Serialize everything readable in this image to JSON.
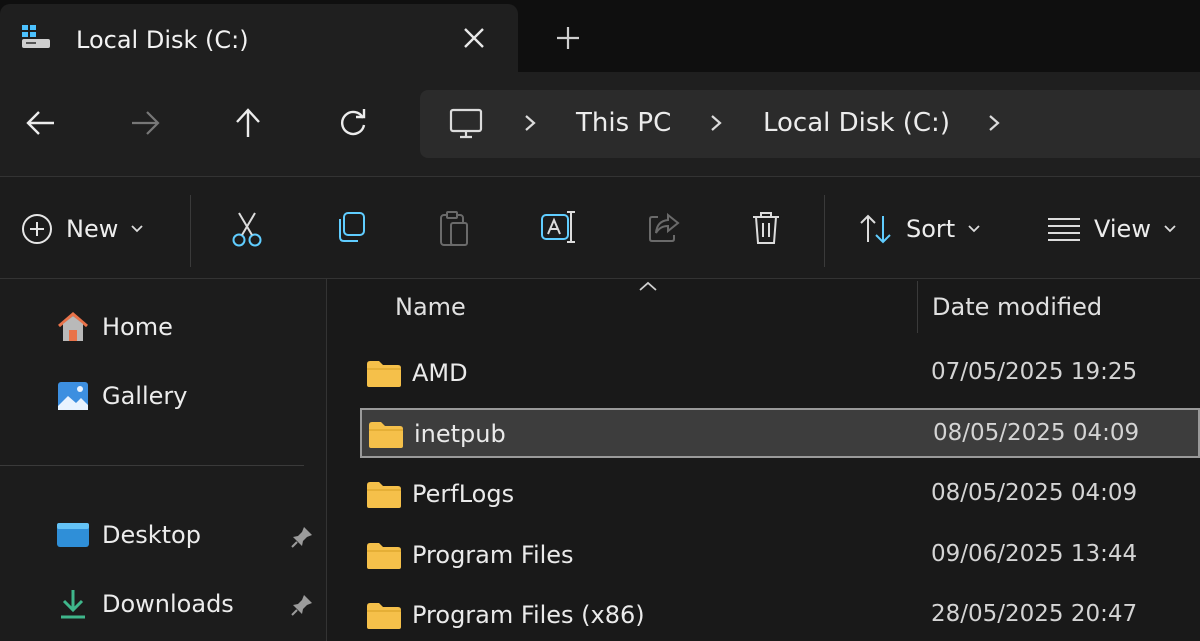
{
  "tab": {
    "title": "Local Disk (C:)"
  },
  "icons": {
    "drive": "drive-icon",
    "close": "close-icon",
    "add": "plus-icon",
    "back": "arrow-left-icon",
    "forward": "arrow-right-icon",
    "up": "arrow-up-icon",
    "refresh": "refresh-icon",
    "pc": "monitor-icon",
    "chevron": "chevron-right-icon",
    "new": "plus-circle-icon",
    "cut": "scissors-icon",
    "copy": "copy-icon",
    "paste": "paste-icon",
    "rename": "rename-icon",
    "share": "share-icon",
    "delete": "trash-icon",
    "sort": "sort-icon",
    "view": "view-icon",
    "folder": "folder-icon",
    "home": "home-icon",
    "gallery": "gallery-icon",
    "desktop": "desktop-icon",
    "downloads": "download-icon",
    "pin": "pin-icon"
  },
  "colors": {
    "accent": "#60cdff",
    "folder": "#f5c04a",
    "selection": "#3d3d3d"
  },
  "breadcrumb": {
    "items": [
      "This PC",
      "Local Disk (C:)"
    ]
  },
  "commandbar": {
    "new_label": "New",
    "sort_label": "Sort",
    "view_label": "View"
  },
  "sidebar": {
    "items": [
      {
        "label": "Home"
      },
      {
        "label": "Gallery"
      },
      {
        "label": "Desktop"
      },
      {
        "label": "Downloads"
      }
    ]
  },
  "columns": {
    "name": "Name",
    "date": "Date modified"
  },
  "files": [
    {
      "name": "AMD",
      "date": "07/05/2025 19:25",
      "selected": false
    },
    {
      "name": "inetpub",
      "date": "08/05/2025 04:09",
      "selected": true
    },
    {
      "name": "PerfLogs",
      "date": "08/05/2025 04:09",
      "selected": false
    },
    {
      "name": "Program Files",
      "date": "09/06/2025 13:44",
      "selected": false
    },
    {
      "name": "Program Files (x86)",
      "date": "28/05/2025 20:47",
      "selected": false
    }
  ]
}
